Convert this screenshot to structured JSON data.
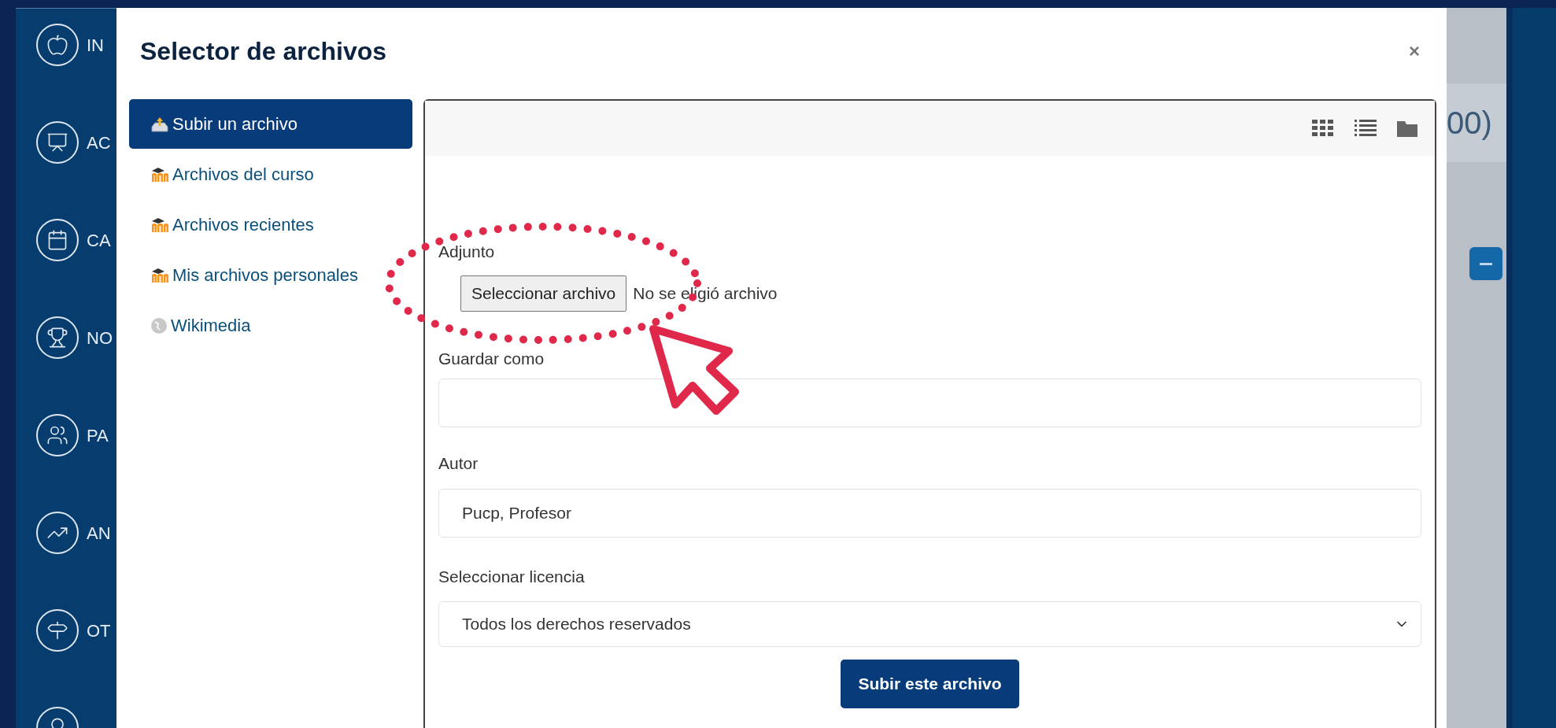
{
  "sidebar": {
    "items": [
      {
        "kind": "apple",
        "label": "IN"
      },
      {
        "kind": "presentation",
        "label": "AC"
      },
      {
        "kind": "calendar",
        "label": "CA"
      },
      {
        "kind": "trophy",
        "label": "NO"
      },
      {
        "kind": "people",
        "label": "PA"
      },
      {
        "kind": "chart",
        "label": "AN"
      },
      {
        "kind": "signpost",
        "label": "OT"
      },
      {
        "kind": "badge"
      }
    ]
  },
  "dialog": {
    "title": "Selector de archivos",
    "close": "×",
    "repositories": [
      {
        "kind": "upload",
        "label": "Subir un archivo",
        "selected": true
      },
      {
        "kind": "moodle",
        "label": "Archivos del curso",
        "selected": false
      },
      {
        "kind": "moodle",
        "label": "Archivos recientes",
        "selected": false
      },
      {
        "kind": "moodle",
        "label": "Mis archivos personales",
        "selected": false
      },
      {
        "kind": "wikimedia",
        "label": "Wikimedia",
        "selected": false
      }
    ],
    "form": {
      "attachment_label": "Adjunto",
      "file_button": "Seleccionar archivo",
      "file_status": "No se eligió archivo",
      "save_as_label": "Guardar como",
      "author_label": "Autor",
      "author_value": "Pucp, Profesor",
      "license_label": "Seleccionar licencia",
      "license_value": "Todos los derechos reservados",
      "submit": "Subir este archivo"
    }
  },
  "background": {
    "heading_fragment": "00)"
  }
}
